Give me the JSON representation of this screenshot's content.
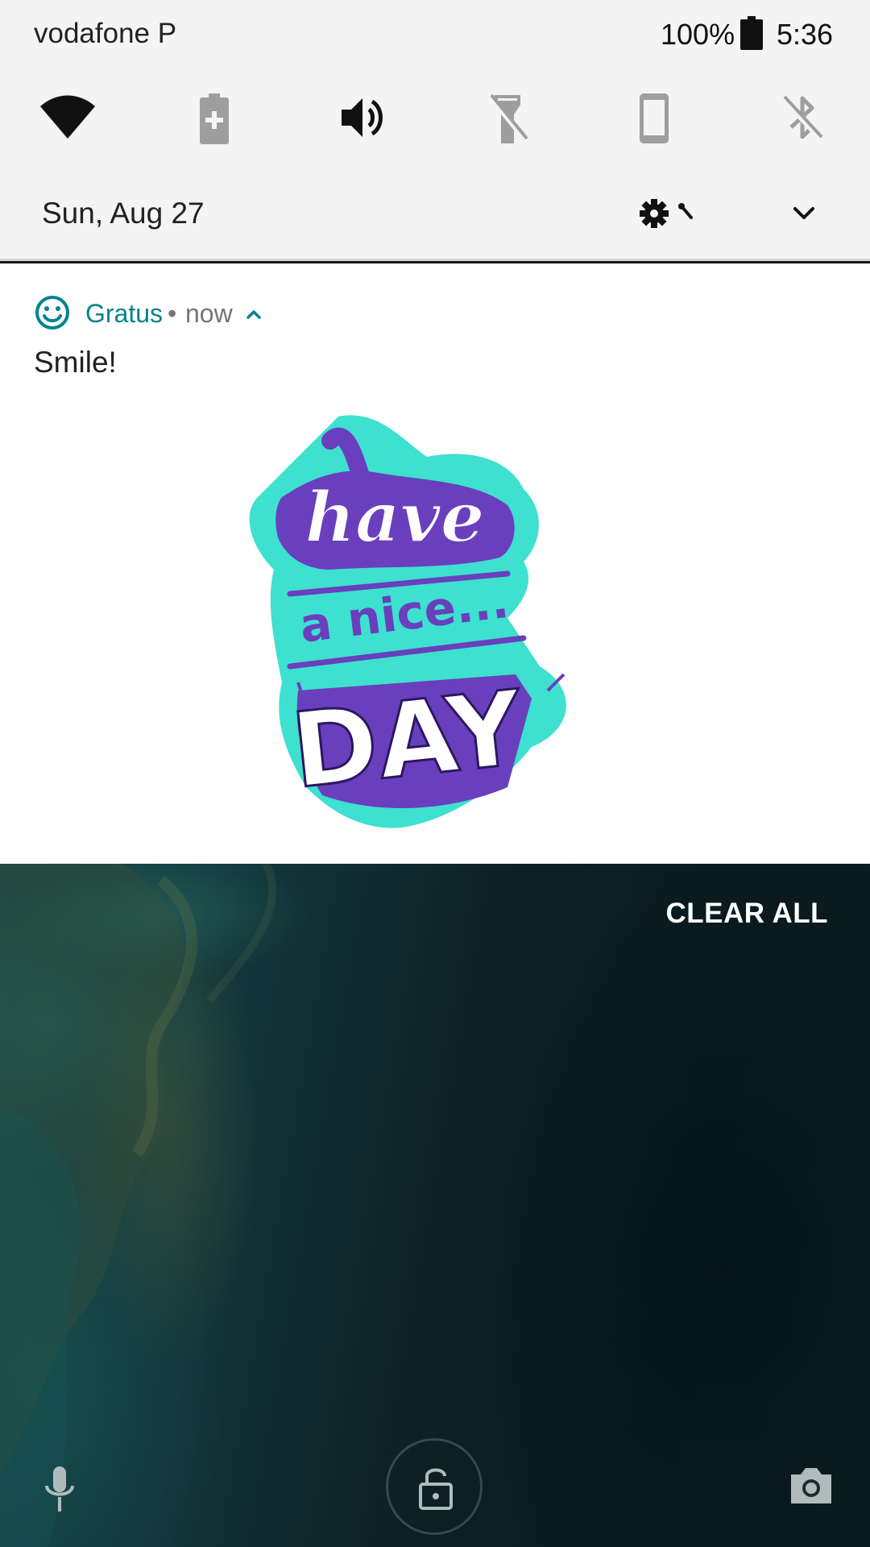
{
  "status_bar": {
    "carrier": "vodafone P",
    "battery_percent": "100%",
    "battery_level": 1.0,
    "time": "5:36"
  },
  "quick_settings": {
    "tiles": [
      {
        "icon": "wifi-icon",
        "state": "on"
      },
      {
        "icon": "battery-saver-icon",
        "state": "off"
      },
      {
        "icon": "volume-icon",
        "state": "on"
      },
      {
        "icon": "flashlight-icon",
        "state": "off"
      },
      {
        "icon": "auto-rotate-icon",
        "state": "off"
      },
      {
        "icon": "bluetooth-icon",
        "state": "off"
      }
    ],
    "date": "Sun, Aug 27"
  },
  "notification": {
    "app_icon": "smiley-icon",
    "app_name": "Gratus",
    "separator": "•",
    "time": "now",
    "title": "Smile!",
    "image_text": "have a nice... DAY"
  },
  "lock_screen": {
    "clear_all": "CLEAR ALL",
    "left_shortcut": "microphone-icon",
    "center": "unlock-icon",
    "right_shortcut": "camera-icon"
  },
  "colors": {
    "accent": "#00838f",
    "shade_bg": "#f4f4f4",
    "tile_active": "#212121",
    "tile_inactive": "#9e9e9e",
    "sticker_purple": "#6a3fbd",
    "sticker_cyan": "#3ee0d0"
  }
}
